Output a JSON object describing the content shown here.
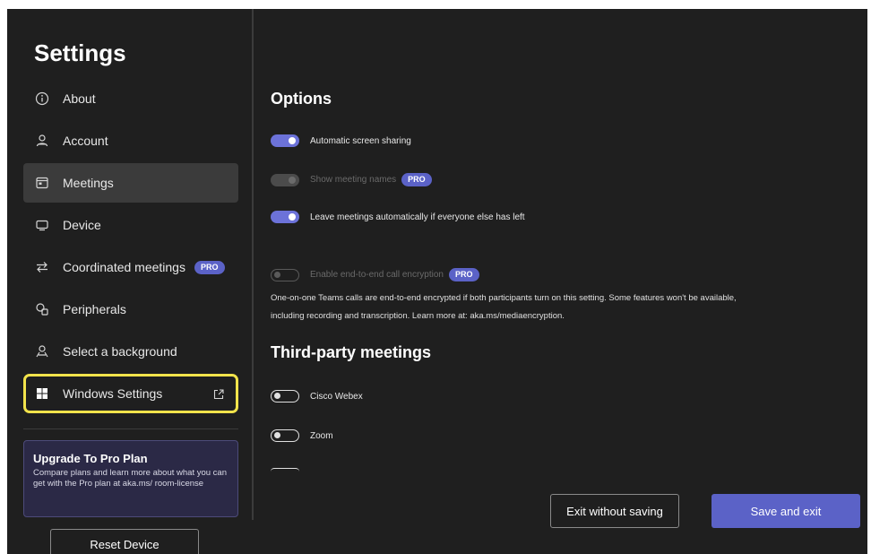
{
  "sidebar": {
    "title": "Settings",
    "items": [
      {
        "label": "About",
        "icon": "info-icon"
      },
      {
        "label": "Account",
        "icon": "account-icon"
      },
      {
        "label": "Meetings",
        "icon": "calendar-icon",
        "selected": true
      },
      {
        "label": "Device",
        "icon": "device-icon"
      },
      {
        "label": "Coordinated meetings",
        "icon": "arrows-icon",
        "badge": "PRO"
      },
      {
        "label": "Peripherals",
        "icon": "peripherals-icon"
      },
      {
        "label": "Select a background",
        "icon": "background-icon"
      },
      {
        "label": "Windows Settings",
        "icon": "windows-icon",
        "external": true,
        "highlighted": true
      }
    ],
    "upgrade": {
      "title": "Upgrade To Pro Plan",
      "text": "Compare plans and learn more about what you can get with the Pro plan at aka.ms/ room-license"
    },
    "reset_label": "Reset Device"
  },
  "main": {
    "options_heading": "Options",
    "options": [
      {
        "label": "Automatic screen sharing",
        "state": "on"
      },
      {
        "label": "Show meeting names",
        "state": "on-disabled",
        "badge": "PRO"
      },
      {
        "label": "Leave meetings automatically if everyone else has left",
        "state": "on"
      },
      {
        "label": "Enable end-to-end call encryption",
        "state": "off-disabled",
        "badge": "PRO"
      }
    ],
    "encryption_desc_line1": "One-on-one Teams calls are end-to-end encrypted if both participants turn on this setting. Some features won't be available,",
    "encryption_desc_line2": "including recording and transcription. Learn more at: aka.ms/mediaencryption.",
    "third_party_heading": "Third-party meetings",
    "third_party": [
      {
        "label": "Cisco Webex",
        "state": "off"
      },
      {
        "label": "Zoom",
        "state": "off"
      }
    ]
  },
  "footer": {
    "exit_label": "Exit without saving",
    "save_label": "Save and exit"
  },
  "colors": {
    "background": "#1f1f1f",
    "accent": "#5b62c7",
    "selected_item": "#3b3b3b",
    "highlight_border": "#f2e34b"
  }
}
